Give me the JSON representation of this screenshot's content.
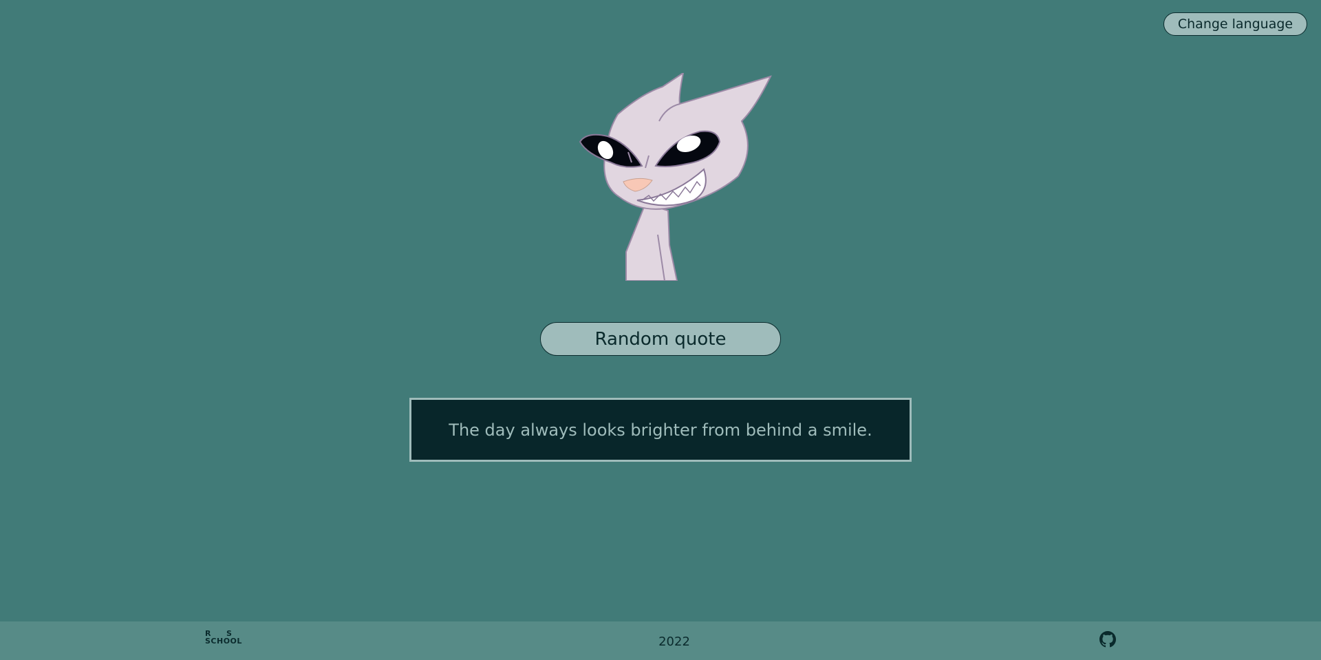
{
  "header": {
    "change_language_label": "Change language"
  },
  "main": {
    "random_quote_label": "Random quote",
    "quote_text": "The day always looks brighter from behind a smile."
  },
  "footer": {
    "logo_top_left": "R",
    "logo_top_right": "S",
    "logo_bottom": "SCHOOL",
    "year": "2022",
    "github_icon": "github-icon"
  },
  "colors": {
    "background": "#417b78",
    "footer": "#578b87",
    "button": "#9fbcbb",
    "quote_box": "#08262a",
    "dark_text": "#0a2a2c"
  }
}
